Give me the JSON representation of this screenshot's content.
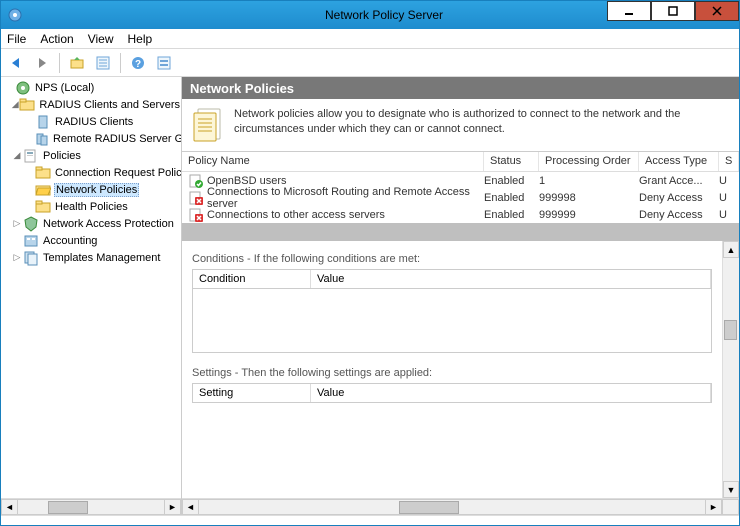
{
  "window": {
    "title": "Network Policy Server"
  },
  "menu": {
    "file": "File",
    "action": "Action",
    "view": "View",
    "help": "Help"
  },
  "tree": {
    "root": "NPS (Local)",
    "radius_group": "RADIUS Clients and Servers",
    "radius_clients": "RADIUS Clients",
    "remote_radius": "Remote RADIUS Server Groups",
    "policies_group": "Policies",
    "conn_req": "Connection Request Policies",
    "net_pol": "Network Policies",
    "health_pol": "Health Policies",
    "nap": "Network Access Protection",
    "accounting": "Accounting",
    "templates": "Templates Management"
  },
  "panel": {
    "header": "Network Policies",
    "info": "Network policies allow you to designate who is authorized to connect to the network and the circumstances under which they can or cannot connect."
  },
  "columns": {
    "name": "Policy Name",
    "status": "Status",
    "order": "Processing Order",
    "access": "Access Type",
    "source": "S"
  },
  "policies": [
    {
      "name": "OpenBSD users",
      "status": "Enabled",
      "order": "1",
      "access": "Grant Acce...",
      "source": "U",
      "allow": true
    },
    {
      "name": "Connections to Microsoft Routing and Remote Access server",
      "status": "Enabled",
      "order": "999998",
      "access": "Deny Access",
      "source": "U",
      "allow": false
    },
    {
      "name": "Connections to other access servers",
      "status": "Enabled",
      "order": "999999",
      "access": "Deny Access",
      "source": "U",
      "allow": false
    }
  ],
  "sections": {
    "conditions_title": "Conditions - If the following conditions are met:",
    "condition_col": "Condition",
    "value_col": "Value",
    "settings_title": "Settings - Then the following settings are applied:",
    "setting_col": "Setting"
  }
}
